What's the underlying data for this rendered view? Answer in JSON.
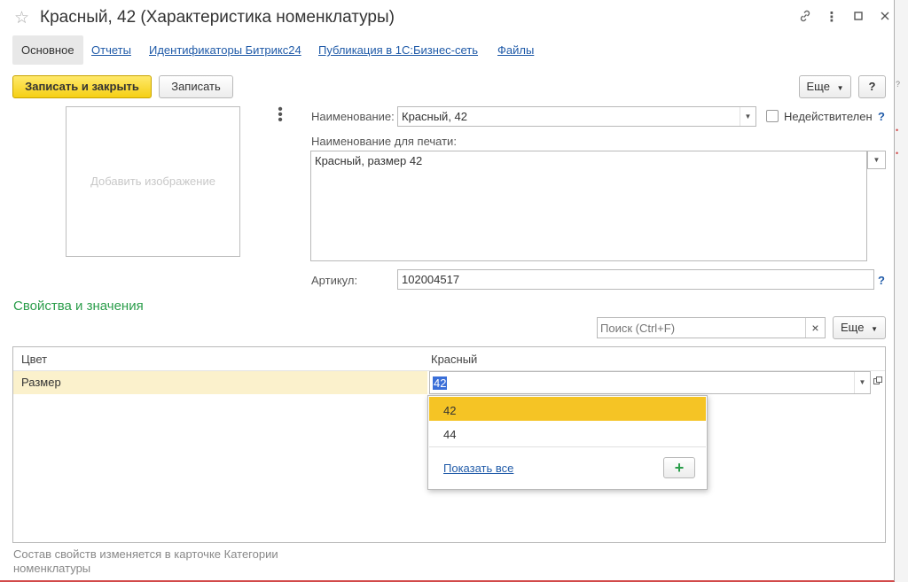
{
  "window": {
    "title": "Красный, 42 (Характеристика номенклатуры)"
  },
  "tabs": [
    {
      "label": "Основное"
    },
    {
      "label": "Отчеты"
    },
    {
      "label": "Идентификаторы Битрикс24"
    },
    {
      "label": "Публикация в 1С:Бизнес-сеть"
    },
    {
      "label": "Файлы"
    }
  ],
  "toolbar": {
    "save_close_label": "Записать и закрыть",
    "save_label": "Записать",
    "more_label": "Еще",
    "help_label": "?"
  },
  "image": {
    "placeholder": "Добавить изображение"
  },
  "form": {
    "name_label": "Наименование:",
    "name_value": "Красный, 42",
    "inactive_label": "Недействителен",
    "print_name_label": "Наименование для печати:",
    "print_name_value": "Красный, размер 42",
    "article_label": "Артикул:",
    "article_value": "102004517",
    "help_mark": "?"
  },
  "properties": {
    "section_title": "Свойства и значения",
    "search_placeholder": "Поиск (Ctrl+F)",
    "more_label": "Еще",
    "columns": [
      "Цвет",
      "Красный"
    ],
    "rows": [
      {
        "property": "Размер",
        "value": "42"
      }
    ],
    "dropdown": {
      "options": [
        "42",
        "44"
      ],
      "selected": "42",
      "show_all_label": "Показать все"
    },
    "footnote": "Состав свойств изменяется в карточке Категории номенклатуры"
  },
  "colors": {
    "accent_yellow": "#f5cf14",
    "section_green": "#2a9d4a",
    "link_blue": "#1f5aa8",
    "selected_row": "#fbf1cc"
  },
  "icons": {
    "favorite": "star-icon",
    "link": "link-icon",
    "menu": "more-vertical-icon",
    "maximize": "maximize-icon",
    "close": "close-icon"
  },
  "strip": [
    "?",
    "•",
    "•"
  ]
}
